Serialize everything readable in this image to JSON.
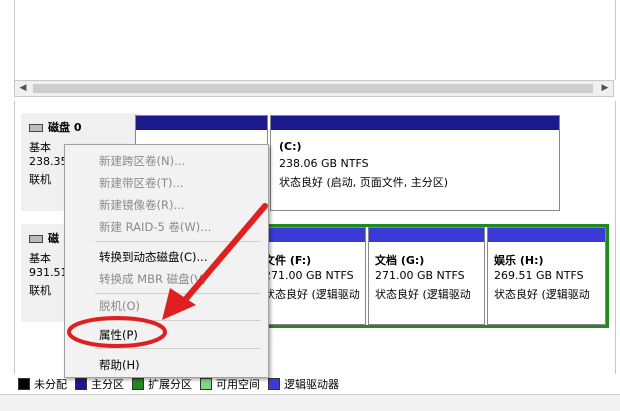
{
  "disks": [
    {
      "name": "磁盘 0",
      "type": "基本",
      "size": "238.35",
      "status": "联机"
    },
    {
      "name": "磁",
      "type": "基本",
      "size": "931.51",
      "status": "联机"
    }
  ],
  "volumes": {
    "c": {
      "label": "(C:)",
      "size": "238.06 GB NTFS",
      "status": "状态良好 (启动, 页面文件, 主分区)"
    },
    "f": {
      "label": "文件  (F:)",
      "size": "271.00 GB NTFS",
      "status": "状态良好 (逻辑驱动"
    },
    "g": {
      "label": "文档  (G:)",
      "size": "271.00 GB NTFS",
      "status": "状态良好 (逻辑驱动"
    },
    "h": {
      "label": "娱乐  (H:)",
      "size": "269.51 GB NTFS",
      "status": "状态良好 (逻辑驱动"
    }
  },
  "context_menu": {
    "items": [
      {
        "label": "新建跨区卷(N)...",
        "enabled": false
      },
      {
        "label": "新建带区卷(T)...",
        "enabled": false
      },
      {
        "label": "新建镜像卷(R)...",
        "enabled": false
      },
      {
        "label": "新建 RAID-5 卷(W)...",
        "enabled": false
      },
      {
        "label": "转换到动态磁盘(C)...",
        "enabled": true
      },
      {
        "label": "转换成 MBR 磁盘(V)",
        "enabled": false
      },
      {
        "label": "脱机(O)",
        "enabled": false
      },
      {
        "label": "属性(P)",
        "enabled": true
      },
      {
        "label": "帮助(H)",
        "enabled": true
      }
    ]
  },
  "legend": [
    {
      "label": "未分配",
      "color": "#000000"
    },
    {
      "label": "主分区",
      "color": "#1a1a8c"
    },
    {
      "label": "扩展分区",
      "color": "#1f8a1f"
    },
    {
      "label": "可用空间",
      "color": "#7fd67f"
    },
    {
      "label": "逻辑驱动器",
      "color": "#3a3ad6"
    }
  ],
  "colors": {
    "primary_bar": "#1a1a8c",
    "extended_border": "#1f8a1f",
    "annotation": "#e02020"
  }
}
